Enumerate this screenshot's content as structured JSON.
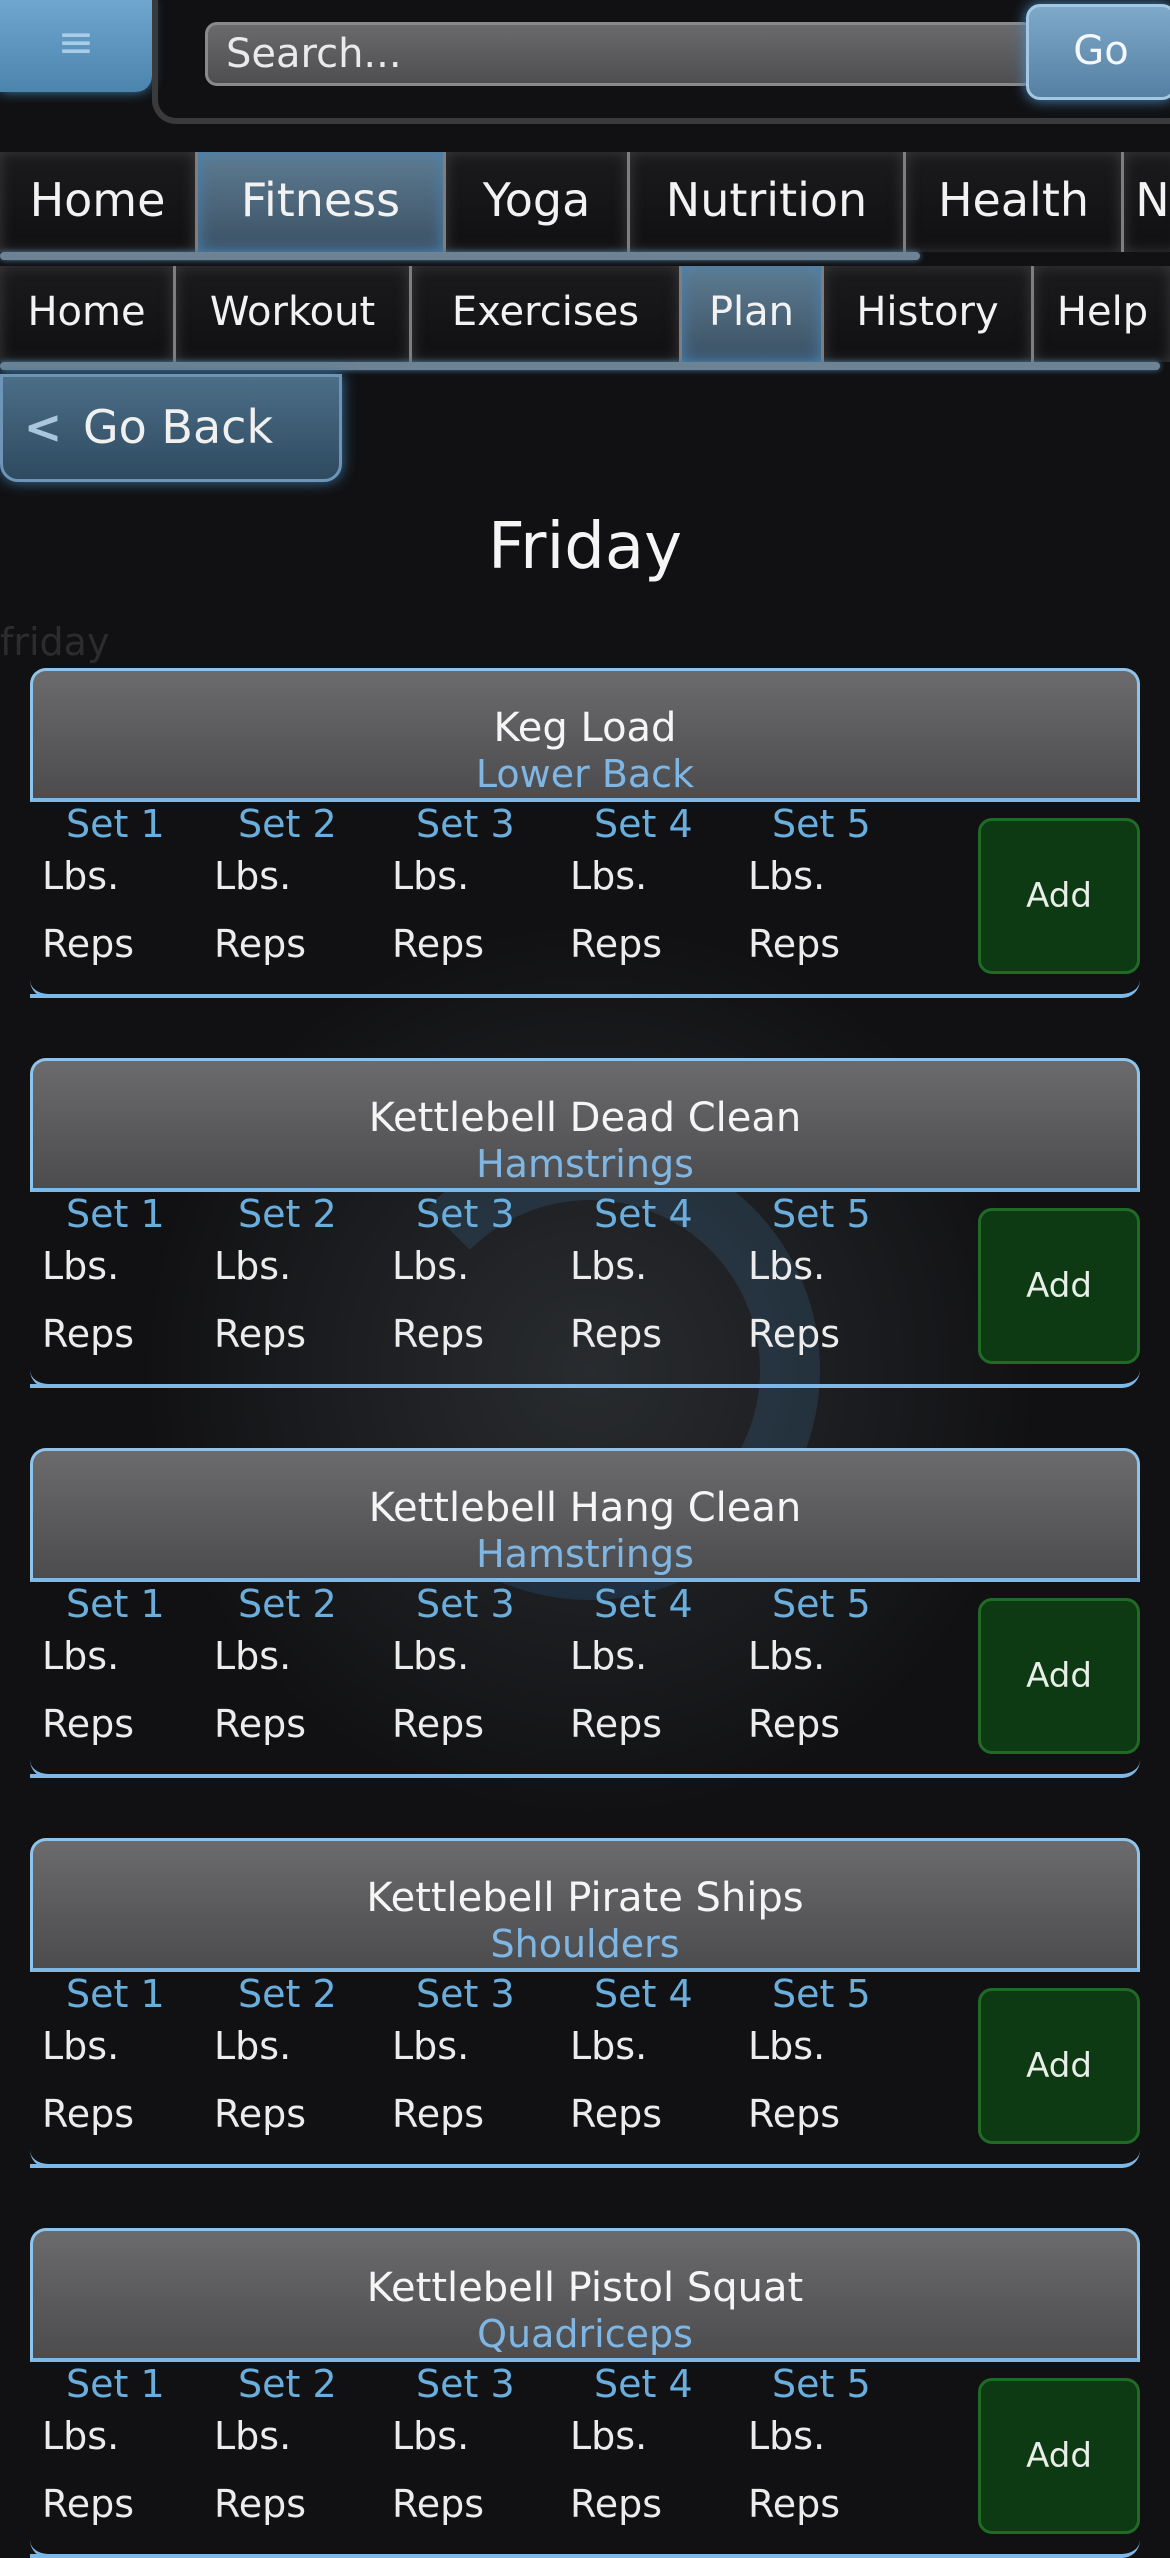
{
  "header": {
    "menu_icon": "hamburger-icon",
    "search_placeholder": "Search...",
    "go_label": "Go"
  },
  "nav_primary": [
    "Home",
    "Fitness",
    "Yoga",
    "Nutrition",
    "Health",
    "N"
  ],
  "nav_primary_active": "Fitness",
  "nav_secondary": [
    "Home",
    "Workout",
    "Exercises",
    "Plan",
    "History",
    "Help"
  ],
  "nav_secondary_active": "Plan",
  "back_label": "Go Back",
  "back_icon": "chevron-left-icon",
  "page_title": "Friday",
  "page_slug": "friday",
  "set_labels": [
    "Set 1",
    "Set 2",
    "Set 3",
    "Set 4",
    "Set 5"
  ],
  "lbs_placeholder": "Lbs.",
  "reps_placeholder": "Reps",
  "add_label": "Add",
  "exercises": [
    {
      "name": "Keg Load",
      "muscle": "Lower Back"
    },
    {
      "name": "Kettlebell Dead Clean",
      "muscle": "Hamstrings"
    },
    {
      "name": "Kettlebell Hang Clean",
      "muscle": "Hamstrings"
    },
    {
      "name": "Kettlebell Pirate Ships",
      "muscle": "Shoulders"
    },
    {
      "name": "Kettlebell Pistol Squat",
      "muscle": "Quadriceps"
    }
  ],
  "colors": {
    "accent_blue": "#7fb6e3",
    "add_green": "#0d3a12",
    "background": "#111113"
  }
}
